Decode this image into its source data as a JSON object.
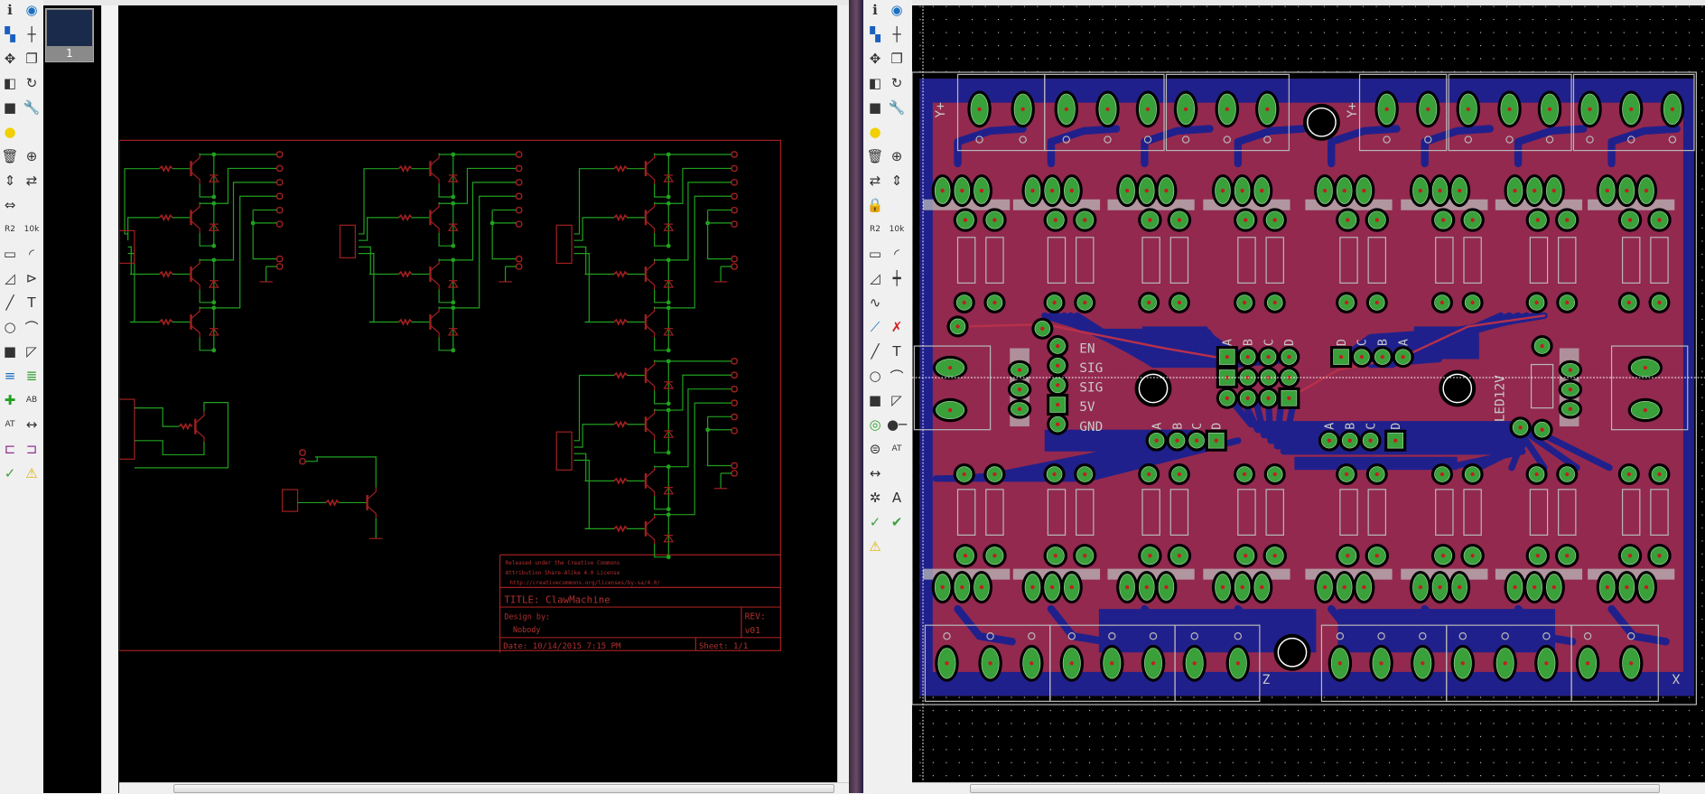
{
  "left_toolbar": {
    "tools": [
      "info-icon",
      "show-icon",
      "layers-icon",
      "mark-icon",
      "move-icon",
      "copy-icon",
      "mirror-icon",
      "rotate-icon",
      "group-icon",
      "change-icon",
      "paste-icon",
      "",
      "delete-icon",
      "add-icon",
      "pinswap-icon",
      "replace-icon",
      "gateswap-icon",
      "",
      "name-icon",
      "value-icon",
      "smash-icon",
      "miter-icon",
      "split-icon",
      "invoke-icon",
      "wire-icon",
      "text-icon",
      "circle-icon",
      "arc-icon",
      "rect-icon",
      "polygon-icon",
      "bus-icon",
      "net-icon",
      "junction-icon",
      "label-icon",
      "attribute-icon",
      "dimension-icon",
      "frame-icon",
      "part-icon",
      "erc-icon",
      "errors-icon"
    ]
  },
  "right_toolbar": {
    "tools": [
      "info-icon",
      "show-icon",
      "layers-icon",
      "mark-icon",
      "move-icon",
      "copy-icon",
      "mirror-icon",
      "rotate-icon",
      "group-icon",
      "change-icon",
      "paste-icon",
      "",
      "delete-icon",
      "add-icon",
      "replace-icon",
      "pinswap-icon",
      "lock-icon",
      "",
      "name-icon",
      "value-icon",
      "smash-icon",
      "miter-icon",
      "split-icon",
      "optimize-icon",
      "meander-icon",
      "",
      "route-icon",
      "ripup-icon",
      "wire-icon",
      "text-icon",
      "circle-icon",
      "arc-icon",
      "rect-icon",
      "polygon-icon",
      "via-icon",
      "signal-icon",
      "hole-icon",
      "attribute-icon",
      "dimension-icon",
      "",
      "ratsnest-icon",
      "autorouter-icon",
      "erc-icon",
      "drc-icon",
      "errors-icon",
      ""
    ]
  },
  "sheets": {
    "items": [
      {
        "label": "1"
      }
    ]
  },
  "schematic": {
    "frame_color": "#a02020",
    "wire_color": "#20a020",
    "license": [
      "Released under the Creative Commons",
      "Attribution Share-Alike 4.0 License",
      "http://creativecommons.org/licenses/by-sa/4.0/"
    ],
    "title": "TITLE: ClawMachine",
    "design_by_label": "Design by:",
    "designer": "Nobody",
    "rev_label": "REV:",
    "rev": "v01",
    "date": "Date: 10/14/2015 7:15 PM",
    "sheet": "Sheet: 1/1"
  },
  "board": {
    "copper_top": "#93294f",
    "copper_bottom": "#20208c",
    "pad_color": "#3aa03a",
    "header_labels": [
      "EN",
      "SIG",
      "SIG",
      "5V",
      "GND"
    ],
    "abcd": [
      "A",
      "B",
      "C",
      "D"
    ],
    "dcba": [
      "D",
      "C",
      "B",
      "A"
    ],
    "led_label": "LED12V",
    "y_label": "Y+",
    "z_label": "Z",
    "x_label": "X"
  }
}
